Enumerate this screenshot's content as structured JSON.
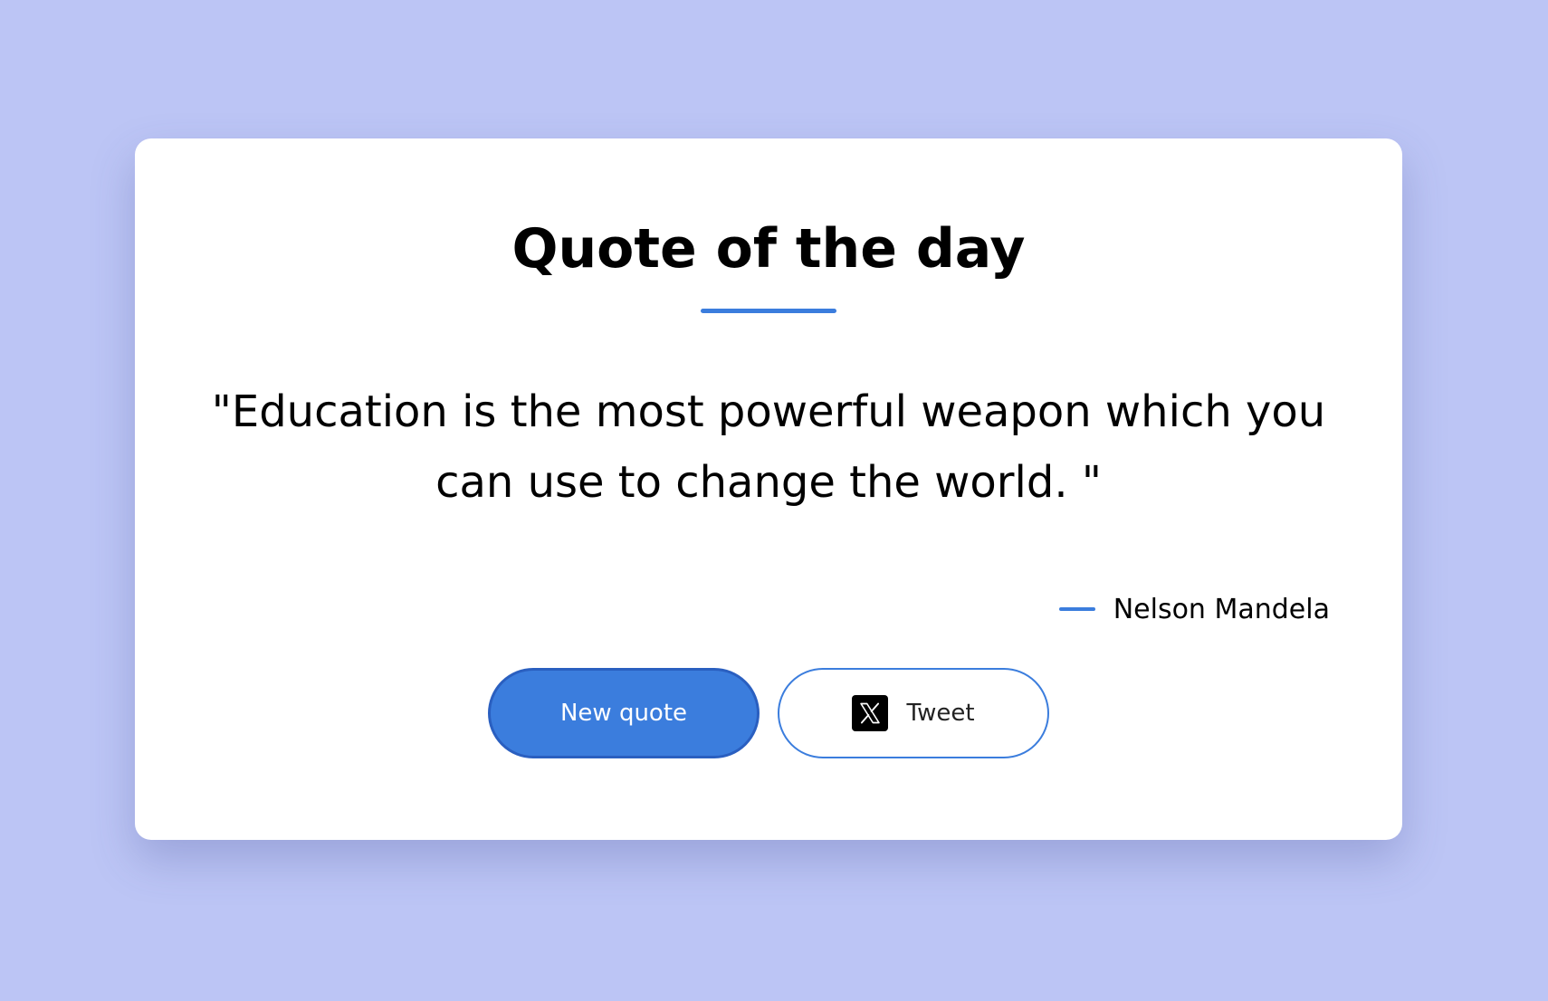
{
  "colors": {
    "background": "#bcc5f5",
    "card": "#ffffff",
    "accent": "#3b7ddd",
    "text": "#000000"
  },
  "card": {
    "title": "Quote of the day",
    "quote": "\"Education is the most powerful weapon which you can use to change the world. \"",
    "author": "Nelson Mandela"
  },
  "actions": {
    "new_quote_label": "New quote",
    "tweet_label": "Tweet",
    "tweet_icon": "x-logo-icon"
  }
}
